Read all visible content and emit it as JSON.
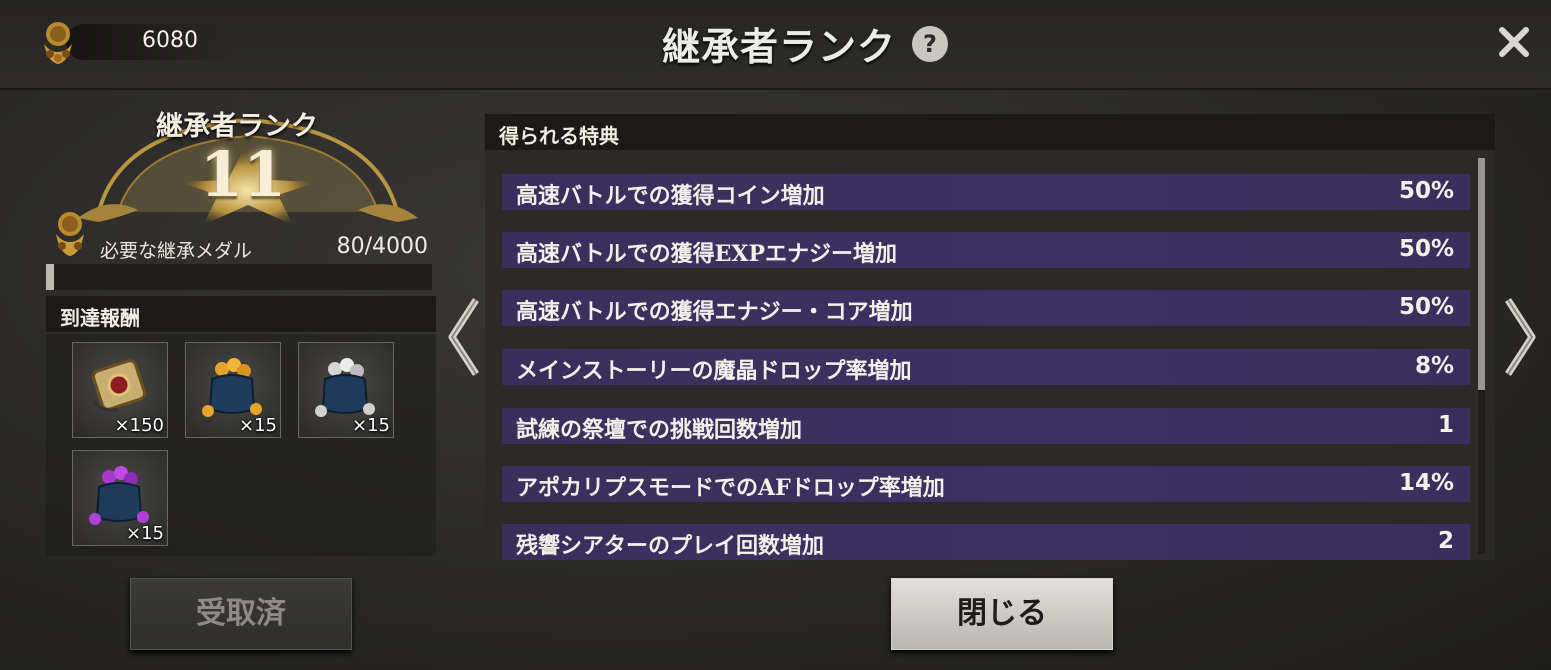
{
  "header": {
    "currency_value": "6080",
    "title": "継承者ランク",
    "help_label": "?",
    "close_label": "✕"
  },
  "rank": {
    "label": "継承者ランク",
    "number": "11",
    "medal_label": "必要な継承メダル",
    "medal_count": "80/4000",
    "progress": 0.02
  },
  "rewards": {
    "title": "到達報酬",
    "items": [
      {
        "icon": "medal-scroll-icon",
        "qty": "×150"
      },
      {
        "icon": "gold-orb-pouch-icon",
        "qty": "×15"
      },
      {
        "icon": "silver-orb-pouch-icon",
        "qty": "×15"
      },
      {
        "icon": "purple-orb-pouch-icon",
        "qty": "×15"
      }
    ],
    "button_label": "受取済"
  },
  "benefits": {
    "title": "得られる特典",
    "rows": [
      {
        "name": "高速バトルでの獲得コイン増加",
        "value": "50%"
      },
      {
        "name": "高速バトルでの獲得EXPエナジー増加",
        "value": "50%"
      },
      {
        "name": "高速バトルでの獲得エナジー・コア増加",
        "value": "50%"
      },
      {
        "name": "メインストーリーの魔晶ドロップ率増加",
        "value": "8%"
      },
      {
        "name": "試練の祭壇での挑戦回数増加",
        "value": "1"
      },
      {
        "name": "アポカリプスモードでのAFドロップ率増加",
        "value": "14%"
      },
      {
        "name": "残響シアターのプレイ回数増加",
        "value": "2"
      }
    ]
  },
  "footer": {
    "close_button_label": "閉じる"
  },
  "colors": {
    "benefit_row": "#3c3160",
    "gold": "#c8a24a"
  }
}
